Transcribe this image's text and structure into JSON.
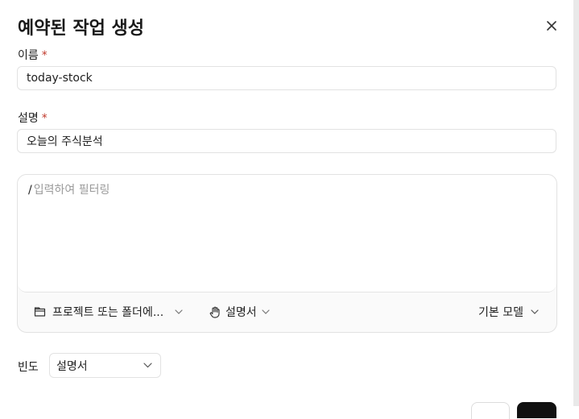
{
  "dialog": {
    "title": "예약된 작업 생성"
  },
  "form": {
    "name_label": "이름",
    "required_mark": "*",
    "name_value": "today-stock",
    "description_label": "설명",
    "description_value": "오늘의 주식분석",
    "prompt_slash": "/",
    "prompt_placeholder": "입력하여 필터링"
  },
  "toolbar": {
    "project_label": "프로젝트 또는 폴더에...",
    "instructions_label": "설명서",
    "model_label": "기본 모델"
  },
  "frequency": {
    "label": "빈도",
    "selected": "설명서"
  },
  "icons": {
    "close": "close-icon",
    "folder": "folder-icon",
    "hand": "hand-icon",
    "chevron": "chevron-down-icon"
  },
  "colors": {
    "required": "#c0392b",
    "primary_button": "#111111"
  }
}
